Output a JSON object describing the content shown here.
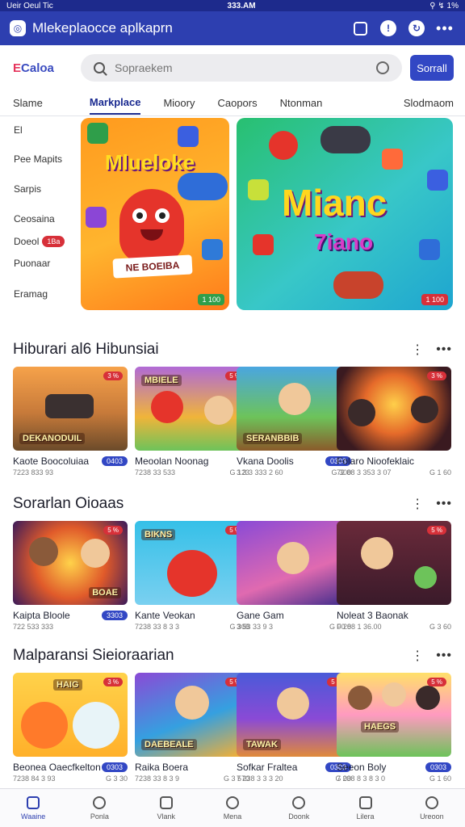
{
  "status_bar": {
    "left": "Ueir Oeul Tic",
    "center": "333.AM",
    "right": "⚲ ↯ 1%"
  },
  "app": {
    "title": "Mlekeplaocce aplkaprn",
    "icons": [
      "clock-icon",
      "info-icon",
      "sync-icon",
      "more-icon"
    ]
  },
  "brand": {
    "name_a": "E",
    "name_b": "Caloa"
  },
  "search": {
    "placeholder": "Sopraekem",
    "button": "Sorrall"
  },
  "tabs": [
    {
      "label": "Slame",
      "active": false
    },
    {
      "label": "Markplace",
      "active": true
    },
    {
      "label": "Mioory",
      "active": false
    },
    {
      "label": "Caopors",
      "active": false
    },
    {
      "label": "Ntonman",
      "active": false
    },
    {
      "label": "Slodmaom",
      "active": false
    }
  ],
  "sidebar": {
    "items": [
      {
        "label": "El",
        "badge": ""
      },
      {
        "label": "Pee Mapits",
        "badge": ""
      },
      {
        "label": "Sarpis",
        "badge": ""
      },
      {
        "label": "Ceosaina",
        "badge": ""
      },
      {
        "label": "Doeol",
        "badge": "1Ba"
      },
      {
        "label": "Puonaar",
        "badge": ""
      },
      {
        "label": "Eramag",
        "badge": ""
      }
    ]
  },
  "banners": [
    {
      "title": "Mlueloke",
      "sign": "NE BOEIBA",
      "corner": "1 100"
    },
    {
      "title_1": "Mianc",
      "title_2": "7iano",
      "corner": "1 100"
    }
  ],
  "sections": [
    {
      "title": "Hiburari al6 Hibunsiai",
      "cards": [
        {
          "name": "Kaote Boocoluiaa",
          "label": "DEKANODUIL",
          "badge": "3 %",
          "price": "0403",
          "meta_a": "7223 833 93",
          "meta_b": ""
        },
        {
          "name": "Meoolan Noonag",
          "label": "MBIELE",
          "badge": "5 %",
          "price": "",
          "meta_a": "7238 33 533",
          "meta_b": "G 123"
        },
        {
          "name": "Vkana Doolis",
          "label": "SERANBBIB",
          "badge": "",
          "price": "0303",
          "meta_a": "3 3 3 333 2 60",
          "meta_b": "G 300"
        },
        {
          "name": "Folaro Nioofeklaic",
          "label": "",
          "badge": "3 %",
          "price": "",
          "meta_a": "72 88 3 353 3 07",
          "meta_b": "G 1 60"
        }
      ]
    },
    {
      "title": "Sorarlan Oioaas",
      "cards": [
        {
          "name": "Kaipta Bloole",
          "label": "BOAE",
          "badge": "5 %",
          "price": "3303",
          "meta_a": "722 533 333",
          "meta_b": ""
        },
        {
          "name": "Kante Veokan",
          "label": "BIKNS",
          "badge": "5 %",
          "price": "",
          "meta_a": "7238 33 8 3 3",
          "meta_b": "G 308"
        },
        {
          "name": "Gane Gam",
          "label": "",
          "badge": "",
          "price": "",
          "meta_a": "3 53 33 9 3",
          "meta_b": "G 00 0"
        },
        {
          "name": "Noleat 3 Baonak",
          "label": "",
          "badge": "5 %",
          "price": "",
          "meta_a": "F 288 1 36.00",
          "meta_b": "G 3 60"
        }
      ]
    },
    {
      "title": "Malparansi Sieioraarian",
      "cards": [
        {
          "name": "Beonea Oaecfkelton",
          "label": "HAIG",
          "badge": "3 %",
          "price": "0303",
          "meta_a": "7238 84 3 93",
          "meta_b": "G 3 30"
        },
        {
          "name": "Raika Boera",
          "label": "DAEBEALE",
          "badge": "5 %",
          "price": "",
          "meta_a": "7238 33 8 3 9",
          "meta_b": "G 3 570"
        },
        {
          "name": "Sofkar Fraltea",
          "label": "TAWAK",
          "badge": "5 %",
          "price": "0303",
          "meta_a": "7 238 3 3 3 20",
          "meta_b": "G 00"
        },
        {
          "name": "Seeon Boly",
          "label": "HAEGS",
          "badge": "5 %",
          "price": "0303",
          "meta_a": "7 238 8 3 8 3 0",
          "meta_b": "G 1 60"
        }
      ]
    }
  ],
  "bottom_nav": [
    {
      "label": "Waaine",
      "icon": "home-icon",
      "active": true
    },
    {
      "label": "Ponla",
      "icon": "search-icon",
      "active": false
    },
    {
      "label": "Vlank",
      "icon": "list-icon",
      "active": false
    },
    {
      "label": "Mena",
      "icon": "clock-icon",
      "active": false
    },
    {
      "label": "Doonk",
      "icon": "user-icon",
      "active": false
    },
    {
      "label": "Lilera",
      "icon": "library-icon",
      "active": false
    },
    {
      "label": "Ureoon",
      "icon": "profile-icon",
      "active": false
    }
  ]
}
